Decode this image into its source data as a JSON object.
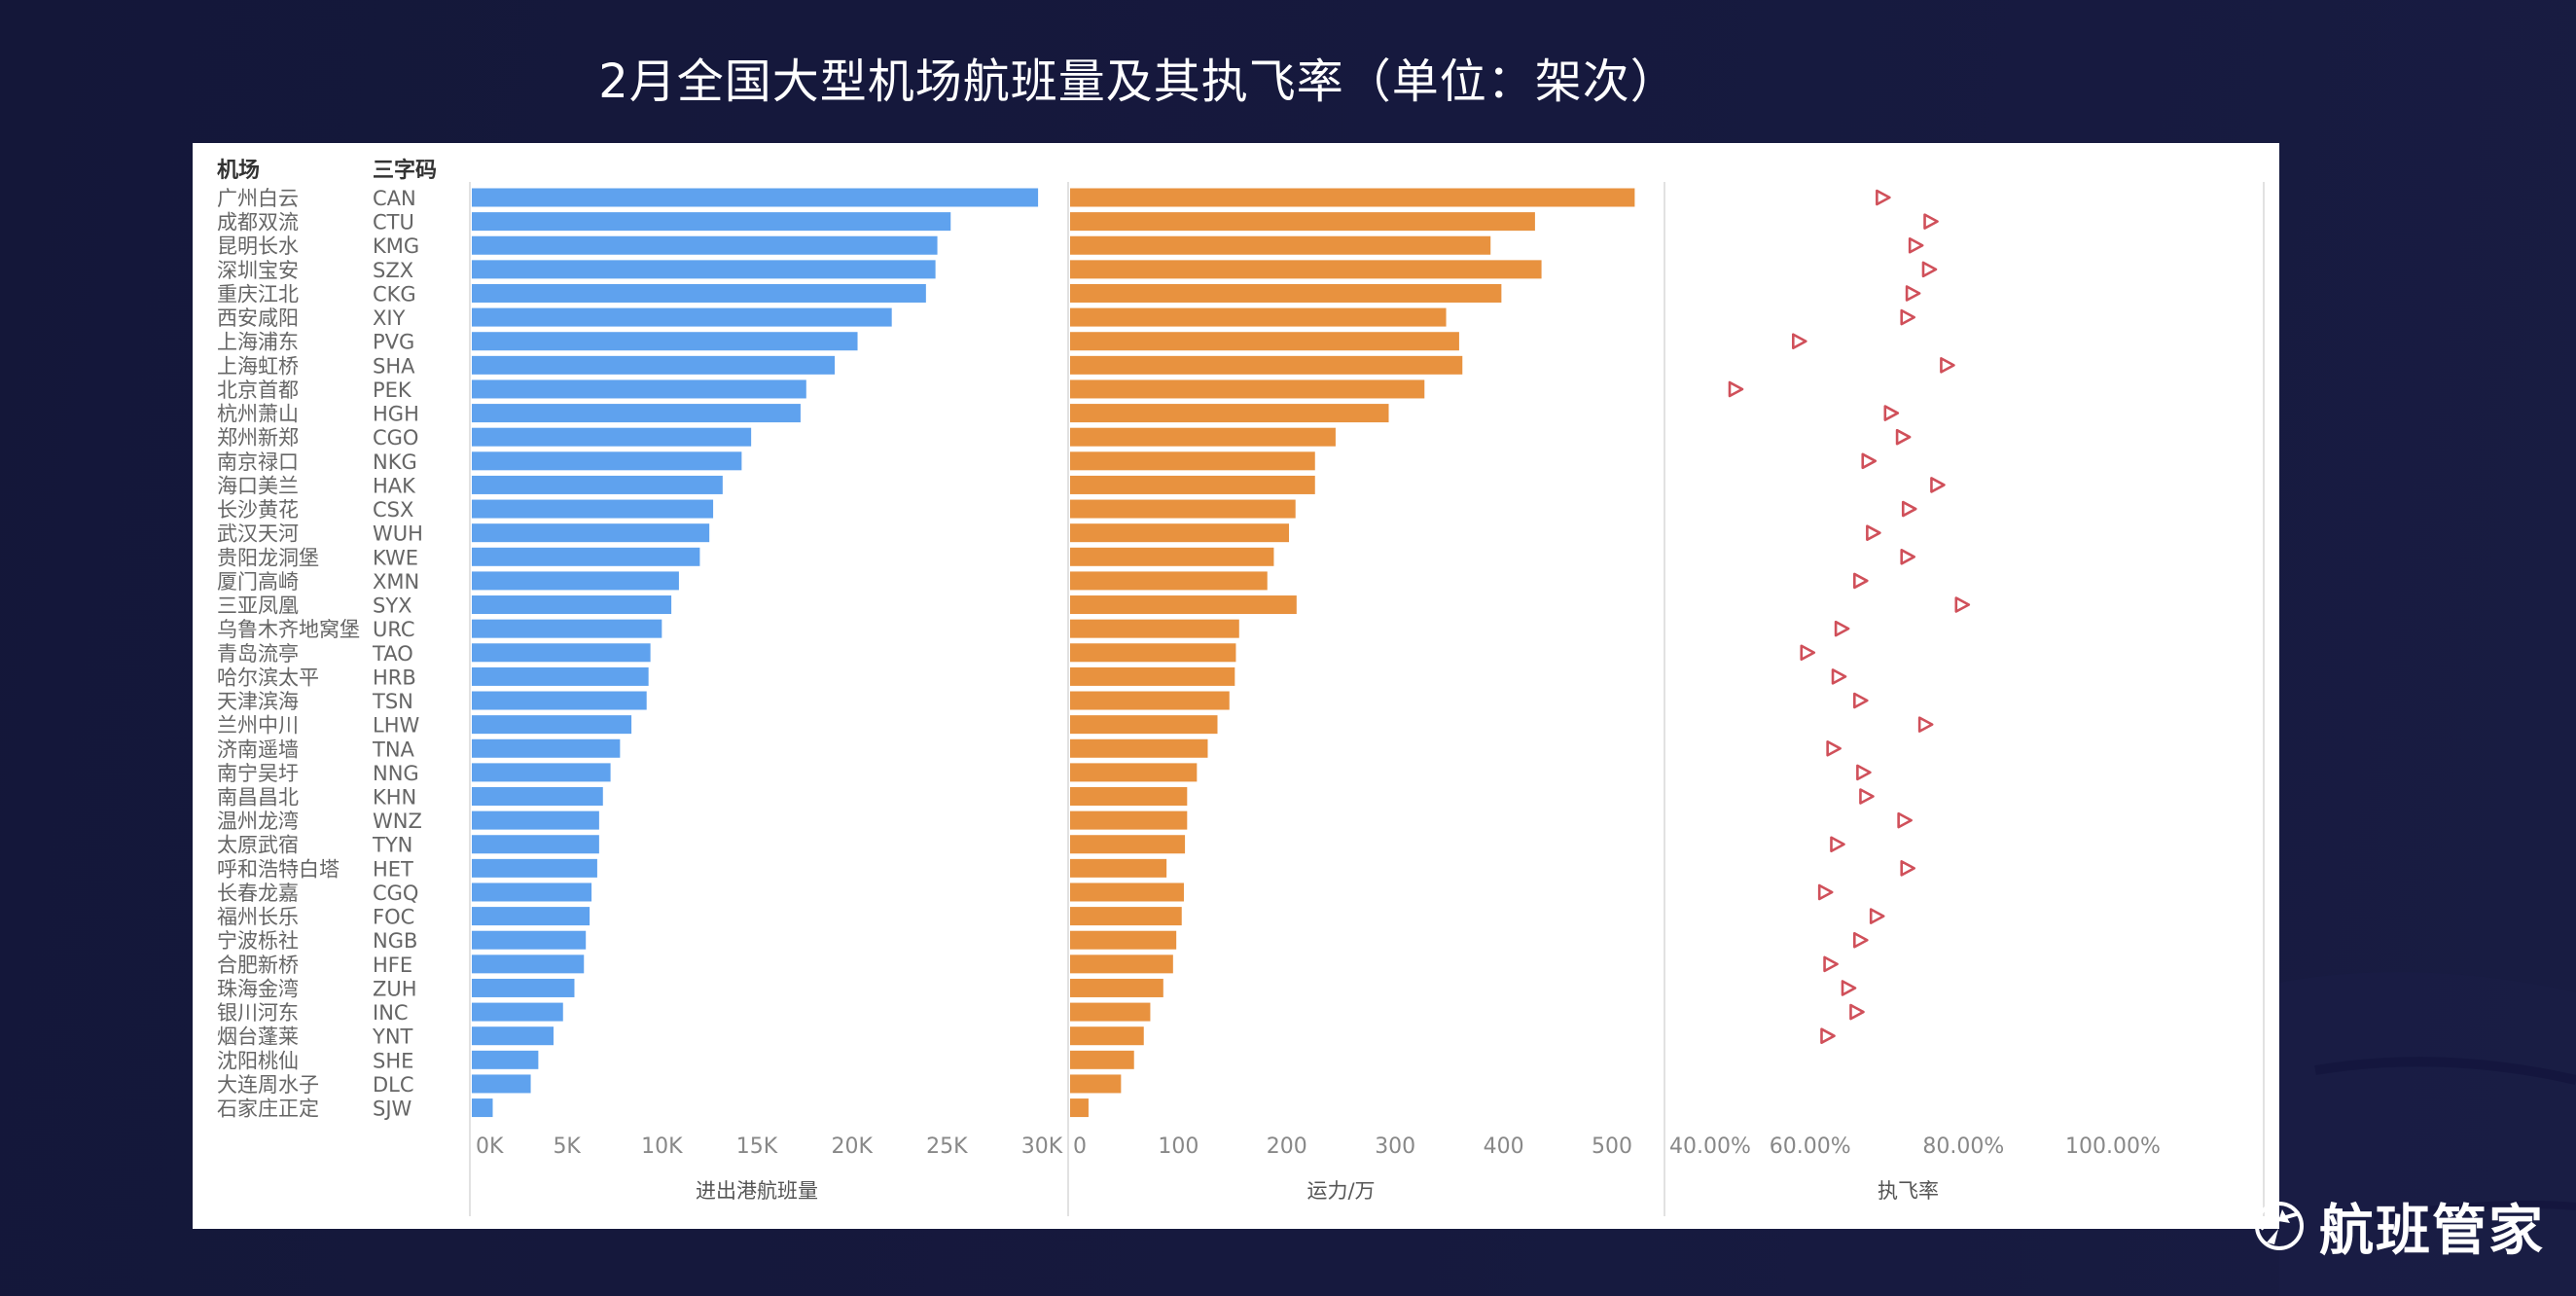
{
  "page": {
    "title": "2月全国大型机场航班量及其执飞率（单位：架次）",
    "brand": "航班管家",
    "brand_icon": "globe-plane-icon"
  },
  "colors": {
    "background": "#16193d",
    "flights_bar": "#5fa2ee",
    "capacity_bar": "#e8923f",
    "rate_marker": "#d0505a",
    "panel": "#ffffff",
    "label_text": "#666666",
    "header_text": "#333333"
  },
  "chart_data": {
    "type": "bar",
    "title": "2月全国大型机场航班量及其执飞率（单位：架次）",
    "columns": {
      "airport_header": "机场",
      "code_header": "三字码"
    },
    "airports": [
      "广州白云",
      "成都双流",
      "昆明长水",
      "深圳宝安",
      "重庆江北",
      "西安咸阳",
      "上海浦东",
      "上海虹桥",
      "北京首都",
      "杭州萧山",
      "郑州新郑",
      "南京禄口",
      "海口美兰",
      "长沙黄花",
      "武汉天河",
      "贵阳龙洞堡",
      "厦门高崎",
      "三亚凤凰",
      "乌鲁木齐地窝堡",
      "青岛流亭",
      "哈尔滨太平",
      "天津滨海",
      "兰州中川",
      "济南遥墙",
      "南宁吴圩",
      "南昌昌北",
      "温州龙湾",
      "太原武宿",
      "呼和浩特白塔",
      "长春龙嘉",
      "福州长乐",
      "宁波栎社",
      "合肥新桥",
      "珠海金湾",
      "银川河东",
      "烟台蓬莱",
      "沈阳桃仙",
      "大连周水子",
      "石家庄正定"
    ],
    "codes": [
      "CAN",
      "CTU",
      "KMG",
      "SZX",
      "CKG",
      "XIY",
      "PVG",
      "SHA",
      "PEK",
      "HGH",
      "CGO",
      "NKG",
      "HAK",
      "CSX",
      "WUH",
      "KWE",
      "XMN",
      "SYX",
      "URC",
      "TAO",
      "HRB",
      "TSN",
      "LHW",
      "TNA",
      "NNG",
      "KHN",
      "WNZ",
      "TYN",
      "HET",
      "CGQ",
      "FOC",
      "NGB",
      "HFE",
      "ZUH",
      "INC",
      "YNT",
      "SHE",
      "DLC",
      "SJW"
    ],
    "panels": [
      {
        "name": "flights",
        "type": "bar",
        "xlabel": "进出港航班量",
        "xlim": [
          0,
          30000
        ],
        "ticks": [
          0,
          5000,
          10000,
          15000,
          20000,
          25000,
          30000
        ],
        "tick_labels": [
          "0K",
          "5K",
          "10K",
          "15K",
          "20K",
          "25K",
          "30K"
        ],
        "values": [
          29800,
          25200,
          24500,
          24400,
          23900,
          22100,
          20300,
          19100,
          17600,
          17300,
          14700,
          14200,
          13200,
          12700,
          12500,
          12000,
          10900,
          10500,
          10000,
          9400,
          9300,
          9200,
          8400,
          7800,
          7300,
          6900,
          6700,
          6700,
          6600,
          6300,
          6200,
          6000,
          5900,
          5400,
          4800,
          4300,
          3500,
          3100,
          1100
        ]
      },
      {
        "name": "capacity",
        "type": "bar",
        "xlabel": "运力/万",
        "xlim": [
          0,
          530
        ],
        "ticks": [
          0,
          100,
          200,
          300,
          400,
          500
        ],
        "tick_labels": [
          "0",
          "100",
          "200",
          "300",
          "400",
          "500"
        ],
        "values": [
          521,
          429,
          388,
          435,
          398,
          347,
          359,
          362,
          327,
          294,
          245,
          226,
          226,
          208,
          202,
          188,
          182,
          209,
          156,
          153,
          152,
          147,
          136,
          127,
          117,
          108,
          108,
          106,
          89,
          105,
          103,
          98,
          95,
          86,
          74,
          68,
          59,
          47,
          17
        ]
      },
      {
        "name": "execution_rate",
        "type": "scatter",
        "marker": "triangle-right",
        "xlabel": "执飞率",
        "xlim": [
          40,
          100
        ],
        "ticks": [
          40,
          60,
          80,
          100
        ],
        "tick_labels": [
          "40.00%",
          "60.00%",
          "80.00%",
          "100.00%"
        ],
        "values": [
          69.2,
          75.6,
          73.6,
          75.4,
          73.2,
          72.5,
          58.0,
          77.8,
          49.5,
          70.3,
          71.9,
          67.3,
          76.5,
          72.7,
          67.9,
          72.5,
          66.2,
          79.8,
          63.7,
          59.1,
          63.3,
          66.2,
          74.9,
          62.6,
          66.6,
          67.0,
          72.1,
          63.1,
          72.5,
          61.5,
          68.4,
          66.2,
          62.2,
          64.6,
          65.7,
          61.8,
          null,
          null,
          null
        ]
      }
    ],
    "grid": false,
    "legend": "none"
  }
}
